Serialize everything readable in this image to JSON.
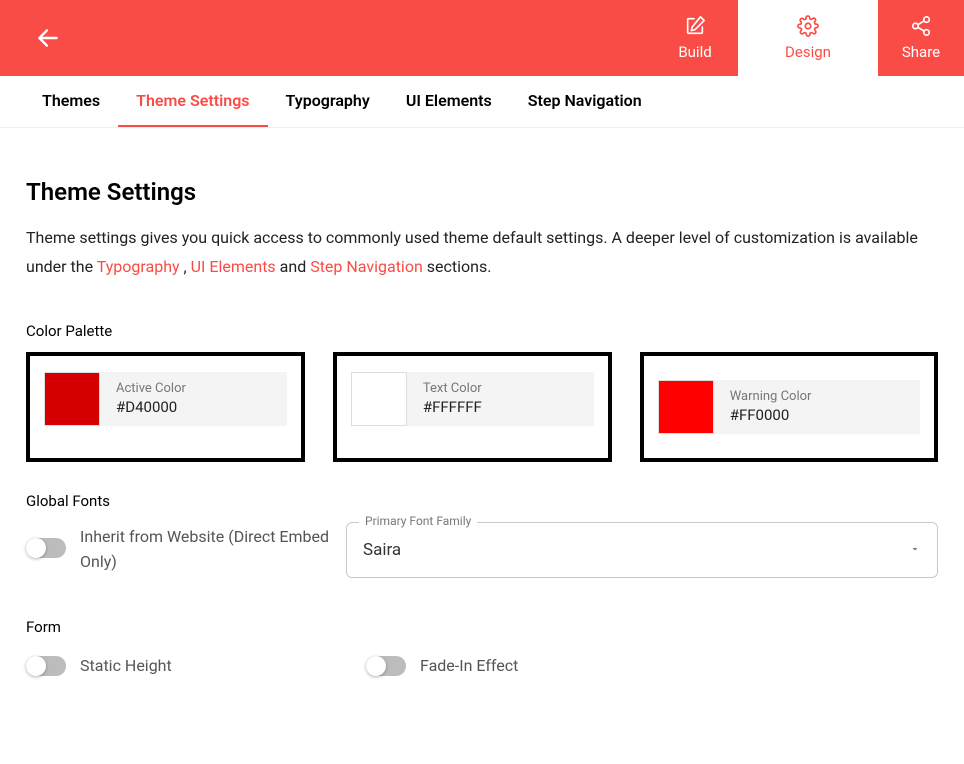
{
  "top": {
    "build": "Build",
    "design": "Design",
    "share": "Share"
  },
  "subtabs": {
    "themes": "Themes",
    "theme_settings": "Theme Settings",
    "typography": "Typography",
    "ui_elements": "UI Elements",
    "step_navigation": "Step Navigation"
  },
  "page": {
    "title": "Theme Settings",
    "desc_1": "Theme settings gives you quick access to commonly used theme default settings. A deeper level of customization is available under the ",
    "link_typography": "Typography",
    "sep1": " , ",
    "link_ui": "UI Elements",
    "sep2": " and ",
    "link_step": "Step Navigation",
    "desc_end": " sections."
  },
  "palette": {
    "section_label": "Color Palette",
    "active": {
      "label": "Active Color",
      "value": "#D40000",
      "color": "#D40000"
    },
    "text": {
      "label": "Text Color",
      "value": "#FFFFFF",
      "color": "#FFFFFF"
    },
    "warning": {
      "label": "Warning Color",
      "value": "#FF0000",
      "color": "#FF0000"
    }
  },
  "fonts": {
    "section_label": "Global Fonts",
    "inherit_label": "Inherit from Website (Direct Embed Only)",
    "select_legend": "Primary Font Family",
    "select_value": "Saira"
  },
  "form": {
    "section_label": "Form",
    "static_height": "Static Height",
    "fade_in": "Fade-In Effect"
  }
}
